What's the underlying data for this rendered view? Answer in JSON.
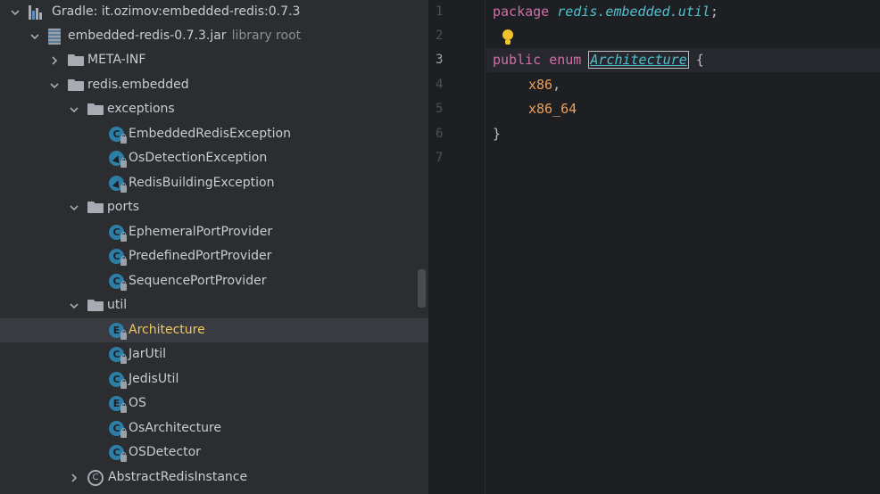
{
  "project_tree": {
    "rows": [
      {
        "label": "Gradle: it.ozimov:embedded-redis:0.7.3",
        "extra": ""
      },
      {
        "label": "embedded-redis-0.7.3.jar",
        "extra": "library root"
      },
      {
        "label": "META-INF",
        "extra": ""
      },
      {
        "label": "redis.embedded",
        "extra": ""
      },
      {
        "label": "exceptions",
        "extra": ""
      },
      {
        "label": "EmbeddedRedisException",
        "extra": ""
      },
      {
        "label": "OsDetectionException",
        "extra": ""
      },
      {
        "label": "RedisBuildingException",
        "extra": ""
      },
      {
        "label": "ports",
        "extra": ""
      },
      {
        "label": "EphemeralPortProvider",
        "extra": ""
      },
      {
        "label": "PredefinedPortProvider",
        "extra": ""
      },
      {
        "label": "SequencePortProvider",
        "extra": ""
      },
      {
        "label": "util",
        "extra": ""
      },
      {
        "label": "Architecture",
        "extra": ""
      },
      {
        "label": "JarUtil",
        "extra": ""
      },
      {
        "label": "JedisUtil",
        "extra": ""
      },
      {
        "label": "OS",
        "extra": ""
      },
      {
        "label": "OsArchitecture",
        "extra": ""
      },
      {
        "label": "OSDetector",
        "extra": ""
      },
      {
        "label": "AbstractRedisInstance",
        "extra": ""
      }
    ],
    "selected_label": "Architecture",
    "class_icon_letters": {
      "class": "C",
      "enum": "E"
    }
  },
  "editor": {
    "line_numbers": [
      "1",
      "2",
      "3",
      "4",
      "5",
      "6",
      "7"
    ],
    "current_line": "3",
    "code": {
      "line1_kw": "package",
      "line1_pkg": "redis.embedded.util",
      "line1_semi": ";",
      "line3_kw": "public enum",
      "line3_name": "Architecture",
      "line3_brace": "{",
      "line4_const": "x86",
      "line4_comma": ",",
      "line5_const": "x86_64",
      "line6_brace": "}"
    },
    "intention_bulb": "lightbulb-icon"
  },
  "colors": {
    "tree_bg": "#2b2d30",
    "editor_bg": "#1e1f22",
    "selected_row": "#393b40",
    "selected_text": "#f0c85f",
    "keyword": "#cf6fa7",
    "package_name": "#4fc1cf",
    "enum_constant": "#c77dbb",
    "bulb": "#f2c12e"
  }
}
